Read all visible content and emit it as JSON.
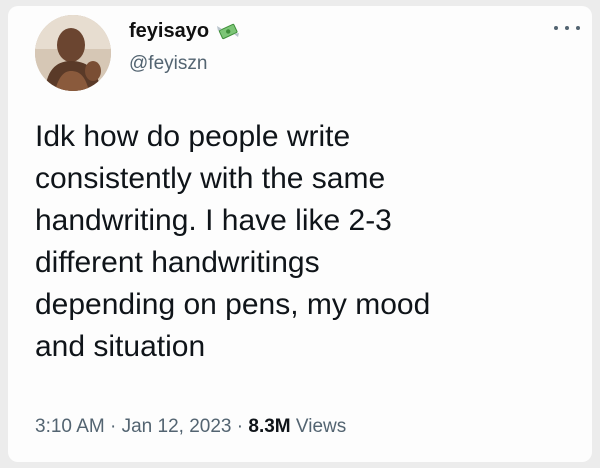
{
  "author": {
    "display_name": "feyisayo",
    "handle": "@feyiszn",
    "badge_icon": "money-with-wings-icon",
    "avatar_icon": "profile-photo"
  },
  "more_icon": "more-horizontal-icon",
  "tweet": {
    "lines": [
      "Idk how do people write",
      "consistently with the same",
      "handwriting. I have like 2-3",
      "different handwritings",
      "depending on pens, my mood",
      "and situation"
    ]
  },
  "meta": {
    "time": "3:10 AM",
    "separator": "·",
    "date": "Jan 12, 2023",
    "views_count": "8.3M",
    "views_label": "Views"
  },
  "colors": {
    "text": "#0f1419",
    "secondary": "#536471",
    "card_bg": "#fdfdfd",
    "page_bg": "#ececec"
  }
}
